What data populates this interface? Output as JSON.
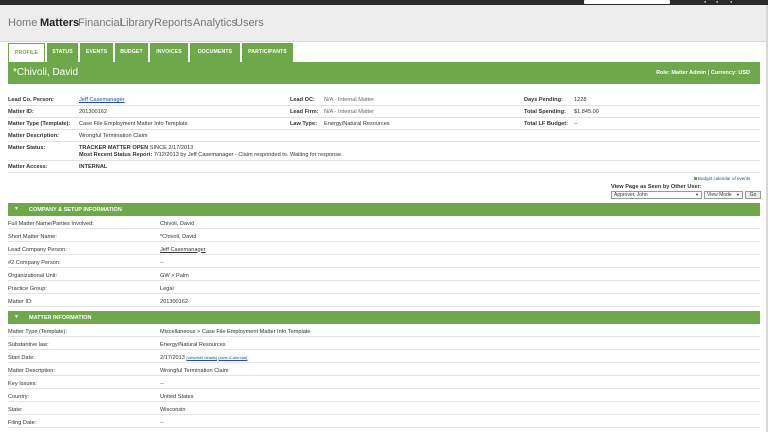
{
  "nav": {
    "items": [
      "Home",
      "Matters",
      "Financial",
      "Library",
      "Reports",
      "Analytics",
      "Users"
    ],
    "active": "Matters"
  },
  "tabs": [
    "PROFILE",
    "STATUS",
    "EVENTS",
    "BUDGET",
    "INVOICES",
    "DOCUMENTS",
    "PARTICIPANTS"
  ],
  "header": {
    "name": "*Chivoli, David",
    "role": "Role: Matter Admin | Currency: USD"
  },
  "summary": {
    "lead_co_person_label": "Lead Co. Person:",
    "lead_co_person_value": "Jeff Casemanager",
    "lead_oc_label": "Lead OC:",
    "lead_oc_value": "N/A - Internal Matter",
    "days_pending_label": "Days Pending:",
    "days_pending_value": "1228",
    "matter_id_label": "Matter ID:",
    "matter_id_value": "201300162",
    "lead_firm_label": "Lead Firm:",
    "lead_firm_value": "N/A - Internal Matter",
    "total_spending_label": "Total Spending:",
    "total_spending_value": "$1,845.00",
    "matter_type_label": "Matter Type (Template):",
    "matter_type_value": "Case File Employment Matter Info Template",
    "law_type_label": "Law Type:",
    "law_type_value": "Energy/Natural Resources",
    "total_lf_budget_label": "Total LF Budget:",
    "total_lf_budget_value": "--",
    "matter_description_label": "Matter Description:",
    "matter_description_value": "Wrongful Termination Claim",
    "matter_status_label": "Matter Status:",
    "matter_status_line1_bold": "TRACKER MATTER OPEN",
    "matter_status_line1_rest": " SINCE 2/17/2013",
    "matter_status_line2_bold": "Most Recent Status Report:",
    "matter_status_line2_rest": " 7/12/2013 by Jeff Casemanager - Claim responded to.  Waiting for response.",
    "matter_access_label": "Matter Access:",
    "matter_access_value": "INTERNAL"
  },
  "budget_legend": "Budget calendar of events",
  "view_as": {
    "label": "View Page as Seen by Other User:",
    "user_selected": "Approver, John",
    "mode_selected": "View Mode",
    "go_label": "Go"
  },
  "company_section": {
    "title": "COMPANY & SETUP INFORMATION",
    "rows": [
      {
        "label": "Full Matter Name/Parties Involved:",
        "value": "Chivoli, David"
      },
      {
        "label": "Short Matter Name:",
        "value": "*Chivoli, David"
      },
      {
        "label": "Lead Company Person:",
        "value": "Jeff Casemanager"
      },
      {
        "label": "#2 Company Person:",
        "value": "--"
      },
      {
        "label": "Organizational Unit:",
        "value": "GW > Palm"
      },
      {
        "label": "Practice Group:",
        "value": "Legal"
      },
      {
        "label": "Matter ID:",
        "value": "201300162"
      }
    ]
  },
  "matter_section": {
    "title": "MATTER INFORMATION",
    "rows": [
      {
        "label": "Matter Type (Template):",
        "value": "Miscellaneous > Case File Employment Matter Info Template"
      },
      {
        "label": "Substantive law:",
        "value": "Energy/Natural Resources"
      },
      {
        "label": "Start Date:",
        "value": "2/17/2013"
      },
      {
        "label": "Matter Description:",
        "value": "Wrongful Termination Claim"
      },
      {
        "label": "Key Issues:",
        "value": "--"
      },
      {
        "label": "Country:",
        "value": "United States"
      },
      {
        "label": "State:",
        "value": "Wisconsin"
      },
      {
        "label": "Filing Date:",
        "value": "--"
      }
    ],
    "start_date_links": [
      "[view/edit details]",
      "[save iCalendar]"
    ]
  },
  "colors": {
    "accent_green": "#6ea84a",
    "link_blue": "#1f4f9d",
    "nav_bg": "#ededed"
  }
}
